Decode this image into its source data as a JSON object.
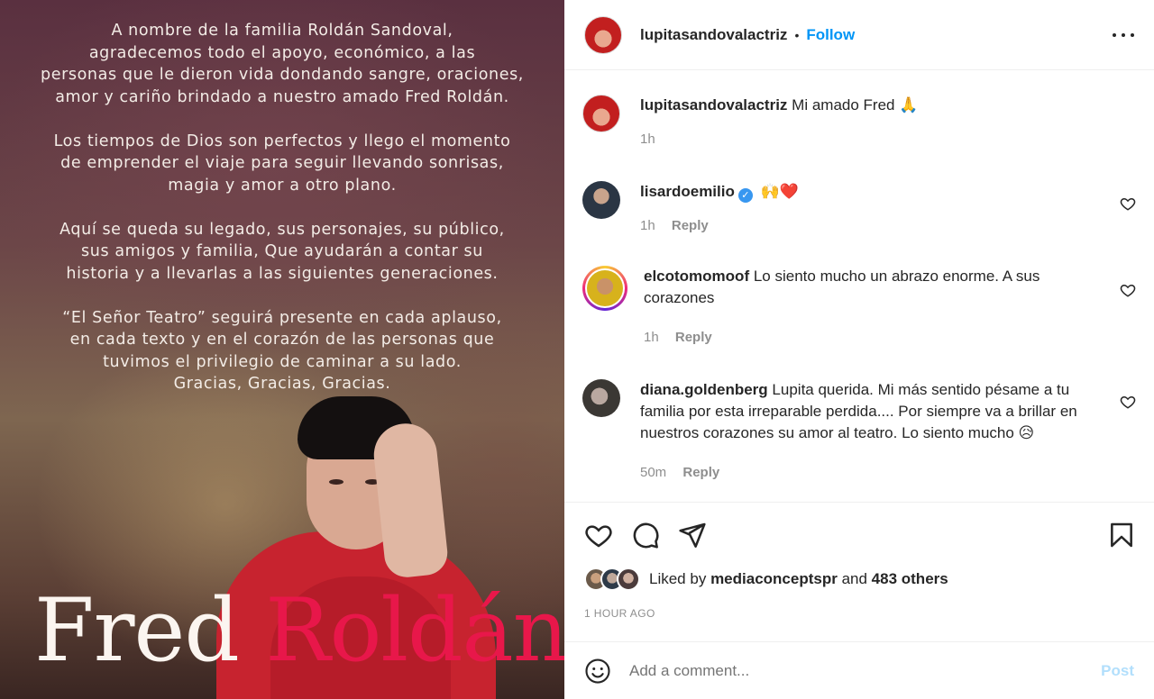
{
  "image": {
    "tribute_paragraphs": [
      [
        "A nombre de la familia Roldán Sandoval,",
        "agradecemos todo el apoyo, económico, a las",
        "personas que le dieron vida dondando sangre, oraciones,",
        "amor y cariño brindado a nuestro amado Fred Roldán."
      ],
      [
        "Los tiempos de Dios son perfectos y llego el momento",
        "de emprender el viaje para seguir llevando sonrisas,",
        "magia y amor a otro plano."
      ],
      [
        "Aquí se queda su legado, sus personajes, su público,",
        "sus amigos y familia, Que ayudarán a contar su",
        "historia y a llevarlas a las siguientes generaciones."
      ],
      [
        "“El Señor Teatro” seguirá presente en cada aplauso,",
        "en cada texto y en el corazón de las personas que",
        "tuvimos el privilegio de caminar a su lado.",
        "Gracias, Gracias, Gracias."
      ]
    ],
    "name_first": "Fred",
    "name_last": "Roldán"
  },
  "header": {
    "username": "lupitasandovalactriz",
    "separator": "•",
    "follow_label": "Follow"
  },
  "comments": [
    {
      "username": "lupitasandovalactriz",
      "text": "Mi amado Fred 🙏",
      "time": "1h",
      "reply": "",
      "verified": false
    },
    {
      "username": "lisardoemilio",
      "text": "🙌❤️",
      "time": "1h",
      "reply": "Reply",
      "verified": true
    },
    {
      "username": "elcotomomoof",
      "text": "Lo siento mucho un abrazo enorme. A sus corazones",
      "time": "1h",
      "reply": "Reply",
      "verified": false
    },
    {
      "username": "diana.goldenberg",
      "text": "Lupita querida. Mi más sentido pésame a tu familia por esta irreparable perdida.... Por siempre va a brillar en nuestros corazones su amor al teatro. Lo siento mucho 😥",
      "time": "50m",
      "reply": "Reply",
      "verified": false
    }
  ],
  "likes": {
    "prefix": "Liked by",
    "user": "mediaconceptspr",
    "joiner": "and",
    "others": "483 others"
  },
  "timestamp": "1 HOUR AGO",
  "add_comment": {
    "placeholder": "Add a comment...",
    "post_label": "Post"
  },
  "colors": {
    "accent": "#0095f6",
    "post_disabled": "#b2dffc",
    "name_last": "#e8174a"
  }
}
